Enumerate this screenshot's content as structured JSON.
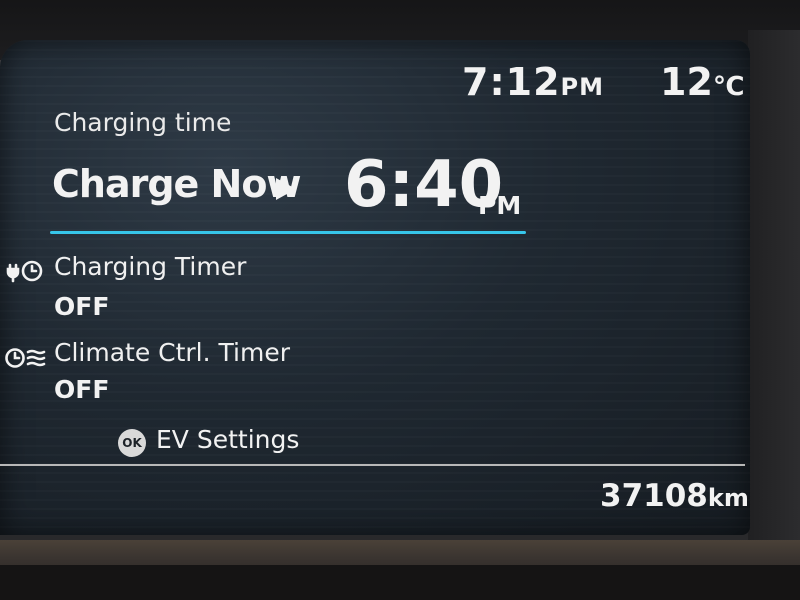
{
  "status": {
    "clock_time": "7:12",
    "clock_ampm": "PM",
    "temperature": "12",
    "temperature_unit": "℃"
  },
  "charging": {
    "section_label": "Charging time",
    "mode_label": "Charge Now",
    "time": "6:40",
    "ampm": "PM"
  },
  "timers": [
    {
      "label": "Charging Timer",
      "value": "OFF",
      "icon": "plug-timer-icon"
    },
    {
      "label": "Climate Ctrl. Timer",
      "value": "OFF",
      "icon": "climate-timer-icon"
    }
  ],
  "footer": {
    "ok_label": "OK",
    "settings_label": "EV Settings",
    "odometer_value": "37108",
    "odometer_unit": "km"
  },
  "colors": {
    "accent_line": "#37c6ea",
    "text": "#f2f2f2",
    "screen_bg": "#1f2831"
  }
}
